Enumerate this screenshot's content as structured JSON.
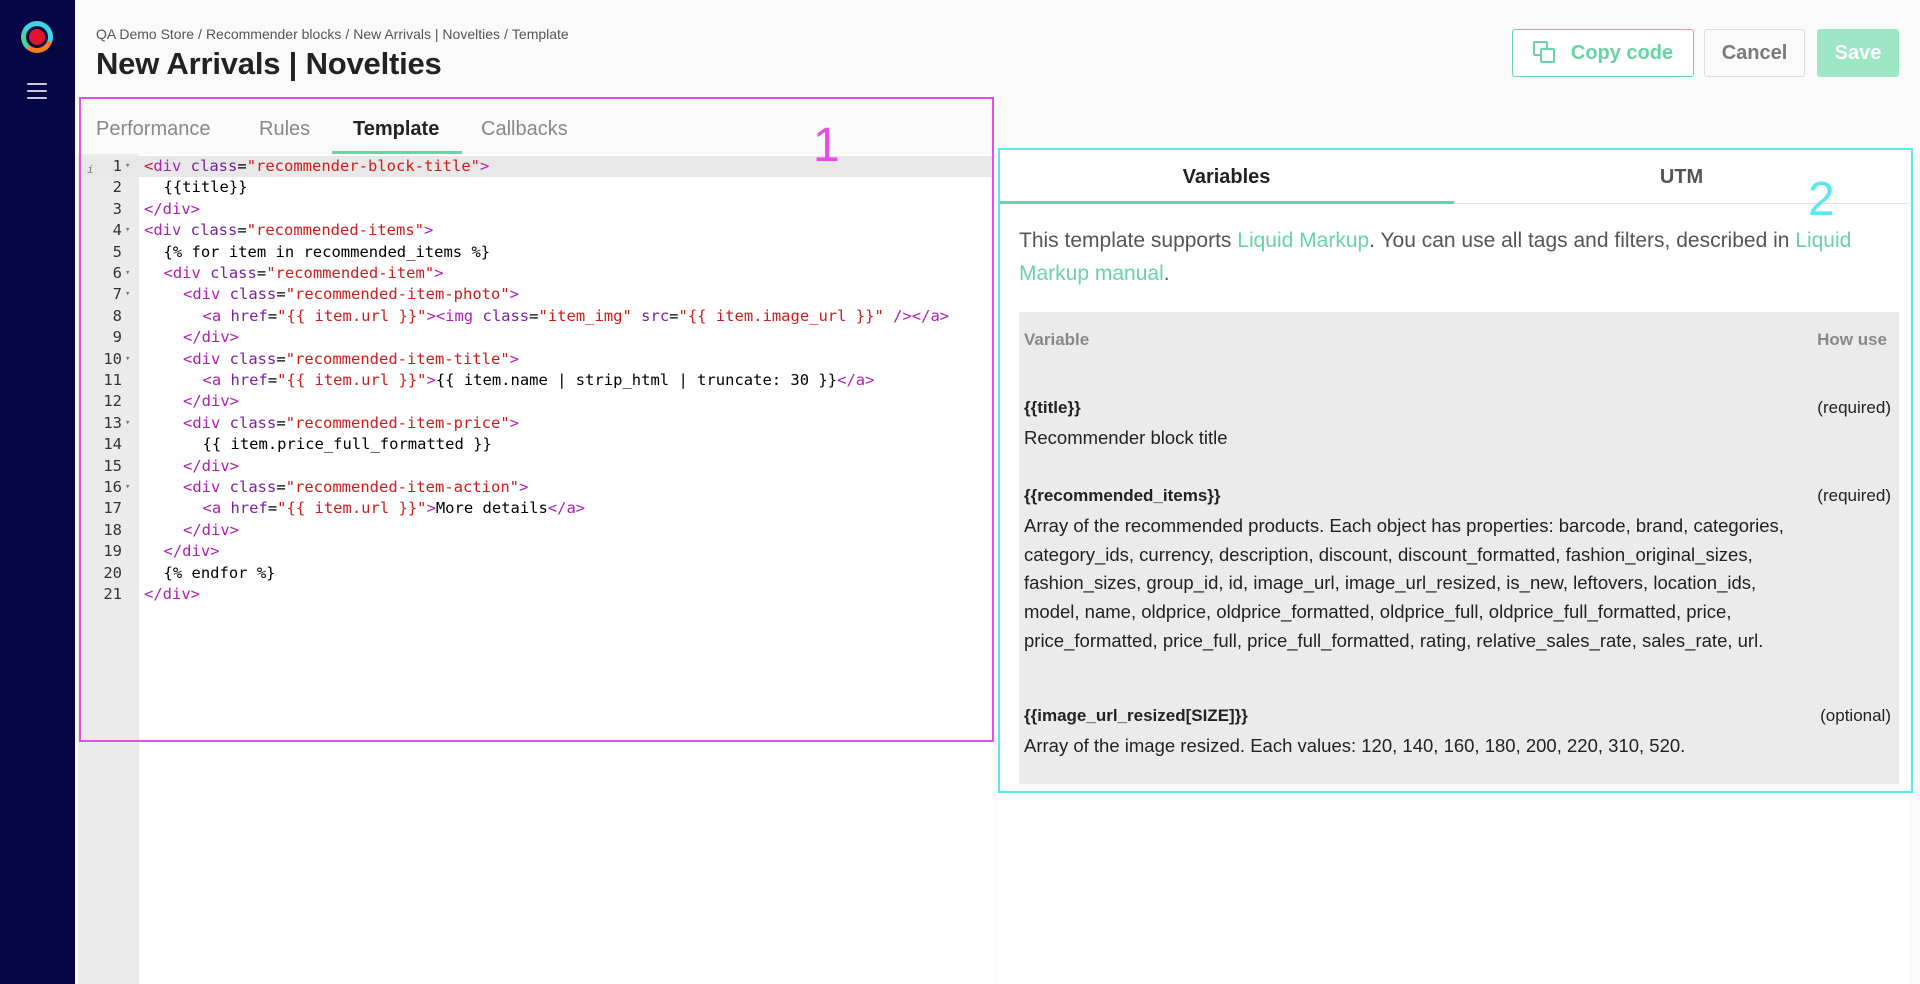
{
  "breadcrumb": [
    "QA Demo Store",
    "/",
    "Recommender blocks",
    "/",
    "New Arrivals | Novelties",
    "/",
    "Template"
  ],
  "page_title": "New Arrivals | Novelties",
  "buttons": {
    "copy": "Copy code",
    "cancel": "Cancel",
    "save": "Save"
  },
  "tabs": [
    "Performance",
    "Rules",
    "Template",
    "Callbacks"
  ],
  "active_tab": "Template",
  "code_lines": [
    {
      "n": "1",
      "fold": true,
      "indent": 0,
      "parts": [
        [
          "t-bracket",
          "<"
        ],
        [
          "t-tag",
          "div "
        ],
        [
          "t-attr",
          "class"
        ],
        [
          "t-txt",
          "="
        ],
        [
          "t-val",
          "\"recommender-block-title\""
        ],
        [
          "t-tag",
          ">"
        ]
      ]
    },
    {
      "n": "2",
      "fold": false,
      "indent": 1,
      "parts": [
        [
          "t-txt",
          "{{title}}"
        ]
      ]
    },
    {
      "n": "3",
      "fold": false,
      "indent": 0,
      "parts": [
        [
          "t-tag",
          "</div>"
        ]
      ]
    },
    {
      "n": "4",
      "fold": true,
      "indent": 0,
      "parts": [
        [
          "t-tag",
          "<div "
        ],
        [
          "t-attr",
          "class"
        ],
        [
          "t-txt",
          "="
        ],
        [
          "t-val",
          "\"recommended-items\""
        ],
        [
          "t-tag",
          ">"
        ]
      ]
    },
    {
      "n": "5",
      "fold": false,
      "indent": 1,
      "parts": [
        [
          "t-txt",
          "{% for item in recommended_items %}"
        ]
      ]
    },
    {
      "n": "6",
      "fold": true,
      "indent": 1,
      "parts": [
        [
          "t-tag",
          "<div "
        ],
        [
          "t-attr",
          "class"
        ],
        [
          "t-txt",
          "="
        ],
        [
          "t-val",
          "\"recommended-item\""
        ],
        [
          "t-tag",
          ">"
        ]
      ]
    },
    {
      "n": "7",
      "fold": true,
      "indent": 2,
      "parts": [
        [
          "t-tag",
          "<div "
        ],
        [
          "t-attr",
          "class"
        ],
        [
          "t-txt",
          "="
        ],
        [
          "t-val",
          "\"recommended-item-photo\""
        ],
        [
          "t-tag",
          ">"
        ]
      ]
    },
    {
      "n": "8",
      "fold": false,
      "indent": 3,
      "parts": [
        [
          "t-tag",
          "<a "
        ],
        [
          "t-attr",
          "href"
        ],
        [
          "t-txt",
          "="
        ],
        [
          "t-val",
          "\"{{ item.url }}\""
        ],
        [
          "t-tag",
          "><img "
        ],
        [
          "t-attr",
          "class"
        ],
        [
          "t-txt",
          "="
        ],
        [
          "t-val",
          "\"item_img\" "
        ],
        [
          "t-attr",
          "src"
        ],
        [
          "t-txt",
          "="
        ],
        [
          "t-val",
          "\"{{ item.image_url }}\" "
        ],
        [
          "t-tag",
          "/></a>"
        ]
      ]
    },
    {
      "n": "9",
      "fold": false,
      "indent": 2,
      "parts": [
        [
          "t-tag",
          "</div>"
        ]
      ]
    },
    {
      "n": "10",
      "fold": true,
      "indent": 2,
      "parts": [
        [
          "t-tag",
          "<div "
        ],
        [
          "t-attr",
          "class"
        ],
        [
          "t-txt",
          "="
        ],
        [
          "t-val",
          "\"recommended-item-title\""
        ],
        [
          "t-tag",
          ">"
        ]
      ]
    },
    {
      "n": "11",
      "fold": false,
      "indent": 3,
      "parts": [
        [
          "t-tag",
          "<a "
        ],
        [
          "t-attr",
          "href"
        ],
        [
          "t-txt",
          "="
        ],
        [
          "t-val",
          "\"{{ item.url }}\""
        ],
        [
          "t-tag",
          ">"
        ],
        [
          "t-txt",
          "{{ item.name | strip_html | truncate: 30 }}"
        ],
        [
          "t-tag",
          "</a>"
        ]
      ]
    },
    {
      "n": "12",
      "fold": false,
      "indent": 2,
      "parts": [
        [
          "t-tag",
          "</div>"
        ]
      ]
    },
    {
      "n": "13",
      "fold": true,
      "indent": 2,
      "parts": [
        [
          "t-tag",
          "<div "
        ],
        [
          "t-attr",
          "class"
        ],
        [
          "t-txt",
          "="
        ],
        [
          "t-val",
          "\"recommended-item-price\""
        ],
        [
          "t-tag",
          ">"
        ]
      ]
    },
    {
      "n": "14",
      "fold": false,
      "indent": 3,
      "parts": [
        [
          "t-txt",
          "{{ item.price_full_formatted }}"
        ]
      ]
    },
    {
      "n": "15",
      "fold": false,
      "indent": 2,
      "parts": [
        [
          "t-tag",
          "</div>"
        ]
      ]
    },
    {
      "n": "16",
      "fold": true,
      "indent": 2,
      "parts": [
        [
          "t-tag",
          "<div "
        ],
        [
          "t-attr",
          "class"
        ],
        [
          "t-txt",
          "="
        ],
        [
          "t-val",
          "\"recommended-item-action\""
        ],
        [
          "t-tag",
          ">"
        ]
      ]
    },
    {
      "n": "17",
      "fold": false,
      "indent": 3,
      "parts": [
        [
          "t-tag",
          "<a "
        ],
        [
          "t-attr",
          "href"
        ],
        [
          "t-txt",
          "="
        ],
        [
          "t-val",
          "\"{{ item.url }}\""
        ],
        [
          "t-tag",
          ">"
        ],
        [
          "t-txt",
          "More details"
        ],
        [
          "t-tag",
          "</a>"
        ]
      ]
    },
    {
      "n": "18",
      "fold": false,
      "indent": 2,
      "parts": [
        [
          "t-tag",
          "</div>"
        ]
      ]
    },
    {
      "n": "19",
      "fold": false,
      "indent": 1,
      "parts": [
        [
          "t-tag",
          "</div>"
        ]
      ]
    },
    {
      "n": "20",
      "fold": false,
      "indent": 1,
      "parts": [
        [
          "t-txt",
          "{% endfor %}"
        ]
      ]
    },
    {
      "n": "21",
      "fold": false,
      "indent": 0,
      "parts": [
        [
          "t-tag",
          "</div>"
        ]
      ]
    }
  ],
  "annotations": {
    "one": "1",
    "two": "2"
  },
  "right_tabs": [
    "Variables",
    "UTM"
  ],
  "intro": {
    "prefix": "This template supports ",
    "link1": "Liquid Markup",
    "middle": ". You can use all tags and filters, described in ",
    "link2": "Liquid Markup manual",
    "suffix": "."
  },
  "variables_table": {
    "header_variable": "Variable",
    "header_how": "How use",
    "rows": [
      {
        "name": "{{title}}",
        "req": "(required)",
        "desc": "Recommender block title"
      },
      {
        "name": "{{recommended_items}}",
        "req": "(required)",
        "desc": "Array of the recommended products. Each object has properties: barcode, brand, categories, category_ids, currency, description, discount, discount_formatted, fashion_original_sizes, fashion_sizes, group_id, id, image_url, image_url_resized, is_new, leftovers, location_ids, model, name, oldprice, oldprice_formatted, oldprice_full, oldprice_full_formatted, price, price_formatted, price_full, price_full_formatted, rating, relative_sales_rate, sales_rate, url."
      },
      {
        "name": "{{image_url_resized[SIZE]}}",
        "req": "(optional)",
        "desc": "Array of the image resized. Each values: 120, 140, 160, 180, 200, 220, 310, 520."
      }
    ]
  },
  "colors": {
    "accent": "#69d3a4",
    "sidebar": "#060644",
    "annot1": "#e64ce6",
    "annot2": "#5ae8ee"
  }
}
